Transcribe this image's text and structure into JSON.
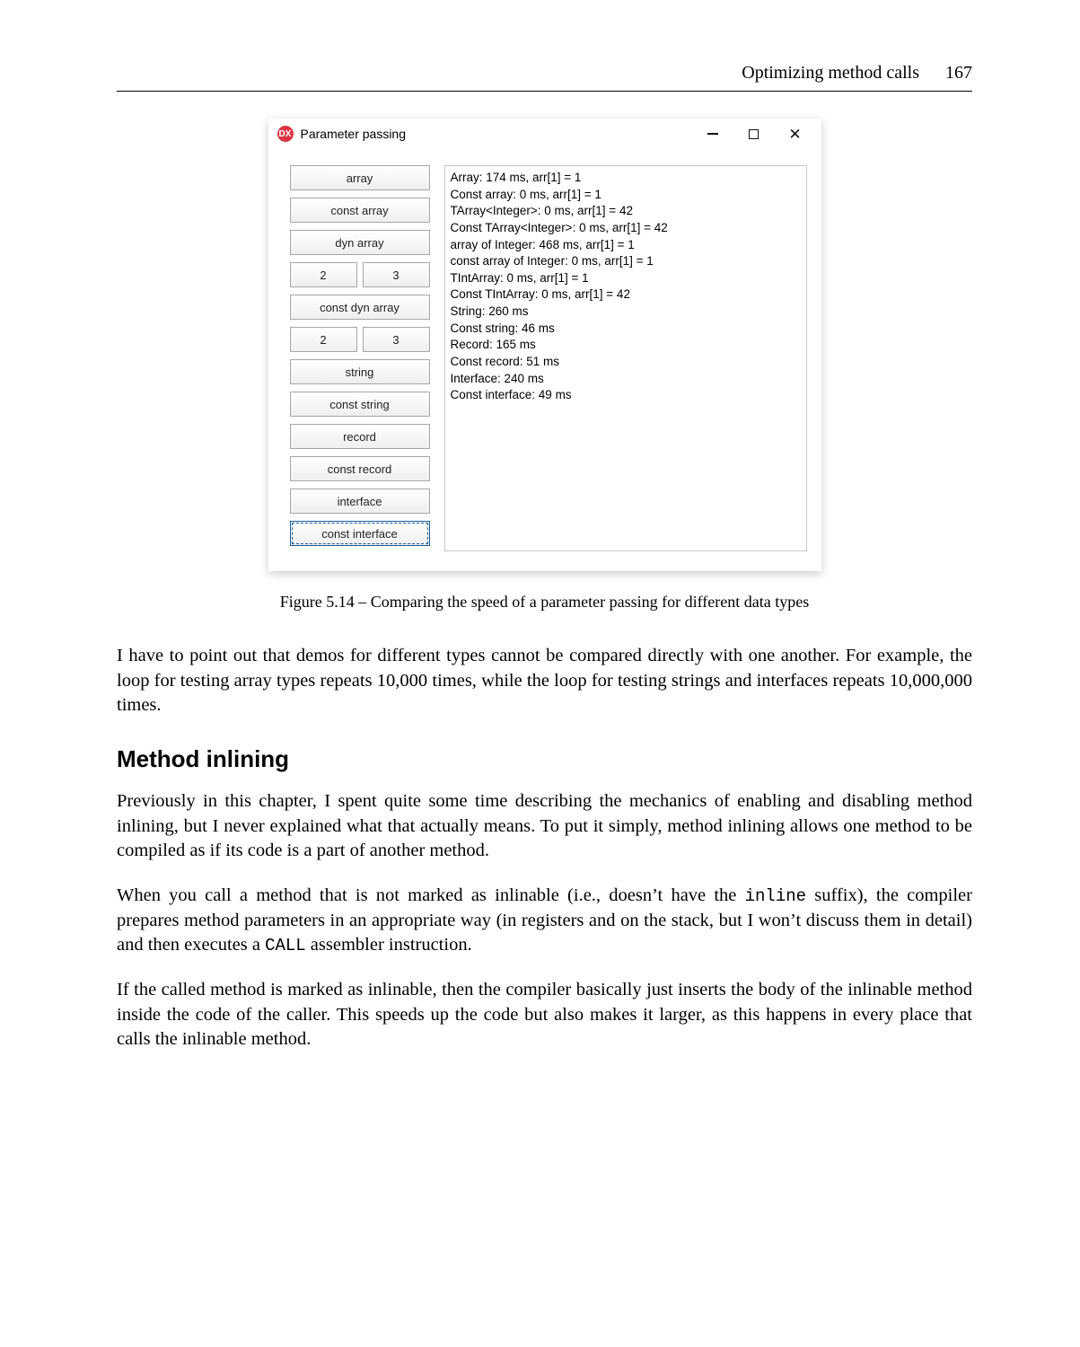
{
  "header": {
    "title": "Optimizing method calls",
    "page_number": "167"
  },
  "window": {
    "app_icon_label": "DX",
    "title": "Parameter passing",
    "sys": {
      "minimize": "minimize",
      "maximize": "maximize",
      "close": "close"
    },
    "buttons": {
      "b0": "array",
      "b1": "const array",
      "b2": "dyn array",
      "pair1_a": "2",
      "pair1_b": "3",
      "b4": "const dyn array",
      "pair2_a": "2",
      "pair2_b": "3",
      "b6": "string",
      "b7": "const string",
      "b8": "record",
      "b9": "const record",
      "b10": "interface",
      "b11": "const interface"
    },
    "output": "Array: 174 ms, arr[1] = 1\nConst array: 0 ms, arr[1] = 1\nTArray<Integer>: 0 ms, arr[1] = 42\nConst TArray<Integer>: 0 ms, arr[1] = 42\narray of Integer: 468 ms, arr[1] = 1\nconst array of Integer: 0 ms, arr[1] = 1\nTIntArray: 0 ms, arr[1] = 1\nConst TIntArray: 0 ms, arr[1] = 42\nString: 260 ms\nConst string: 46 ms\nRecord: 165 ms\nConst record: 51 ms\nInterface: 240 ms\nConst interface: 49 ms"
  },
  "caption": "Figure 5.14 – Comparing the speed of a parameter passing for different data types",
  "paragraphs": {
    "p1": "I have to point out that demos for different types cannot be compared directly with one another. For example, the loop for testing array types repeats 10,000 times, while the loop for testing strings and interfaces repeats 10,000,000 times.",
    "h": "Method inlining",
    "p2": "Previously in this chapter, I spent quite some time describing the mechanics of enabling and disabling method inlining, but I never explained what that actually means. To put it simply, method inlining allows one method to be compiled as if its code is a part of another method.",
    "p3a": "When you call a method that is not marked as inlinable (i.e., doesn’t have the ",
    "p3_inline": "inline",
    "p3b": " suffix), the compiler prepares method parameters in an appropriate way (in registers and on the stack, but I won’t discuss them in detail) and then executes a ",
    "p3_call": "CALL",
    "p3c": " assembler instruction.",
    "p4": "If the called method is marked as inlinable, then the compiler basically just inserts the body of the inlinable method inside the code of the caller. This speeds up the code but also makes it larger, as this happens in every place that calls the inlinable method."
  }
}
